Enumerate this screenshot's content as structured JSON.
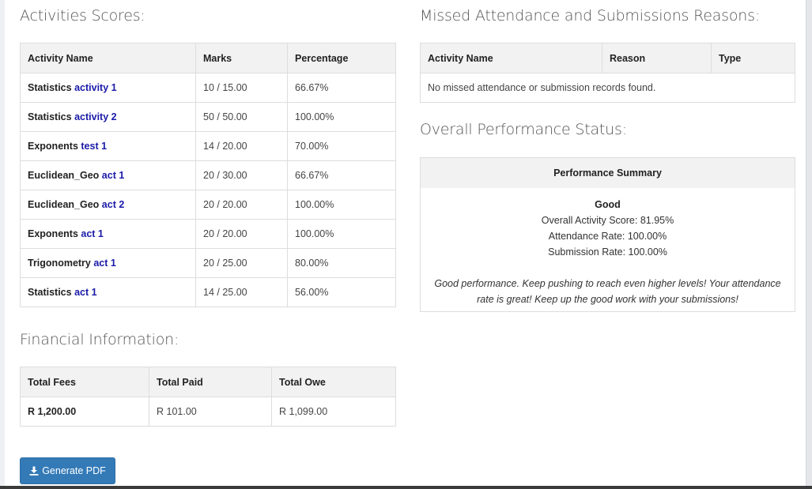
{
  "activities": {
    "title": "Activities Scores:",
    "headers": [
      "Activity Name",
      "Marks",
      "Percentage"
    ],
    "rows": [
      {
        "name_prefix": "Statistics",
        "name_link": "activity 1",
        "marks": "10 / 15.00",
        "percentage": "66.67%"
      },
      {
        "name_prefix": "Statistics",
        "name_link": "activity 2",
        "marks": "50 / 50.00",
        "percentage": "100.00%"
      },
      {
        "name_prefix": "Exponents",
        "name_link": "test 1",
        "marks": "14 / 20.00",
        "percentage": "70.00%"
      },
      {
        "name_prefix": "Euclidean_Geo",
        "name_link": "act 1",
        "marks": "20 / 30.00",
        "percentage": "66.67%"
      },
      {
        "name_prefix": "Euclidean_Geo",
        "name_link": "act 2",
        "marks": "20 / 20.00",
        "percentage": "100.00%"
      },
      {
        "name_prefix": "Exponents",
        "name_link": "act 1",
        "marks": "20 / 20.00",
        "percentage": "100.00%"
      },
      {
        "name_prefix": "Trigonometry",
        "name_link": "act 1",
        "marks": "20 / 25.00",
        "percentage": "80.00%"
      },
      {
        "name_prefix": "Statistics",
        "name_link": "act 1",
        "marks": "14 / 25.00",
        "percentage": "56.00%"
      }
    ]
  },
  "missed": {
    "title": "Missed Attendance and Submissions Reasons:",
    "headers": [
      "Activity Name",
      "Reason",
      "Type"
    ],
    "empty_message": "No missed attendance or submission records found."
  },
  "performance": {
    "title": "Overall Performance Status:",
    "summary_header": "Performance Summary",
    "status": "Good",
    "activity_score": "Overall Activity Score: 81.95%",
    "attendance_rate": "Attendance Rate: 100.00%",
    "submission_rate": "Submission Rate: 100.00%",
    "message_line1": "Good performance. Keep pushing to reach even higher levels! Your attendance",
    "message_line2": "rate is great! Keep up the good work with your submissions!"
  },
  "financial": {
    "title": "Financial Information:",
    "headers": [
      "Total Fees",
      "Total Paid",
      "Total Owe"
    ],
    "total_fees": "R 1,200.00",
    "total_paid": "R 101.00",
    "total_owe": "R 1,099.00"
  },
  "actions": {
    "generate_pdf_label": "Generate PDF",
    "generate_pdf_icon": "download-icon"
  },
  "colors": {
    "link": "#1a1aa8",
    "button": "#337ab7",
    "header_bg": "#f2f2f2"
  }
}
